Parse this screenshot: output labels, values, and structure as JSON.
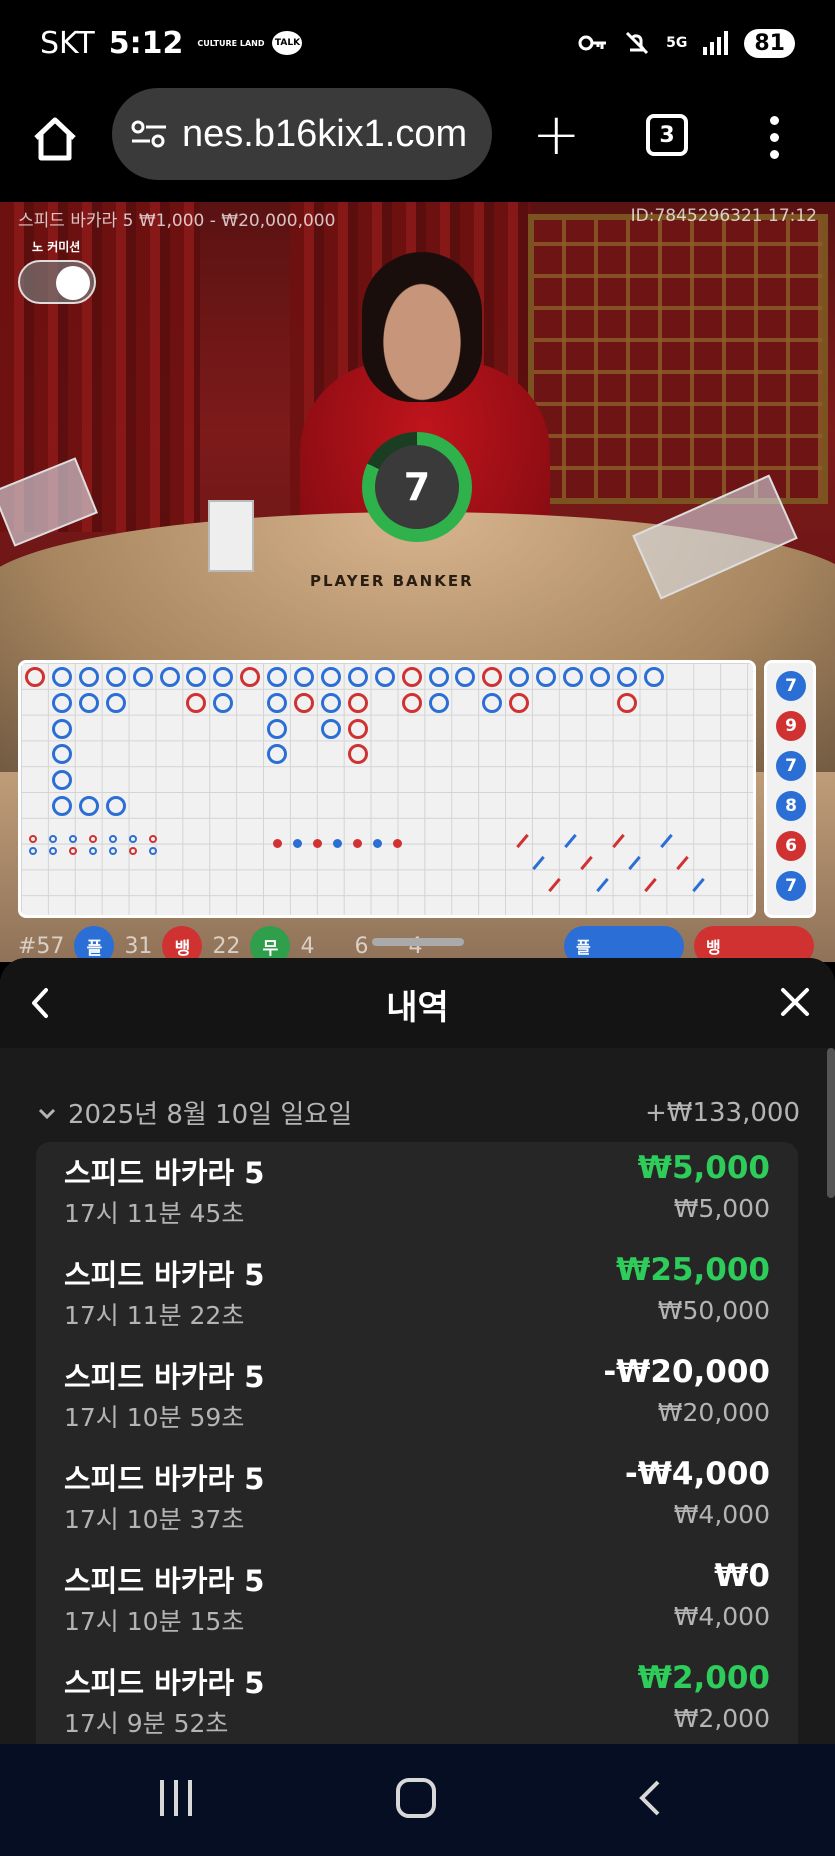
{
  "status_bar": {
    "carrier": "SKT",
    "time": "5:12",
    "culture_land": "CULTURE LAND",
    "talk": "TALK",
    "network": "5G",
    "battery": "81"
  },
  "browser": {
    "url": "nes.b16kix1.com",
    "tab_count": "3"
  },
  "game": {
    "table_info": "스피드 바카라 5  ₩1,000 - ₩20,000,000",
    "round_id": "ID:7845296321  17:12",
    "no_commission_label": "노 커미션",
    "timer_value": "7",
    "table_print": "PLAYER  BANKER",
    "predict_numbers": [
      "7",
      "9",
      "7",
      "8",
      "6",
      "7"
    ],
    "predict_colors": [
      "b",
      "r",
      "b",
      "b",
      "r",
      "b"
    ],
    "stats": {
      "round": "#57",
      "player_label": "플",
      "player_count": "31",
      "banker_label": "뱅",
      "banker_count": "22",
      "tie_label": "무",
      "tie_count": "4",
      "pair1_count": "6",
      "pair2_count": "4",
      "ask_player": "플",
      "ask_banker": "뱅"
    },
    "colors": {
      "player": "#2b6fd6",
      "banker": "#d03232",
      "tie": "#2f9f4b"
    }
  },
  "history_sheet": {
    "title": "내역",
    "date": "2025년 8월 10일 일요일",
    "date_total": "+₩133,000",
    "items": [
      {
        "game": "스피드 바카라 5",
        "time": "17시 11분 45초",
        "result": "₩5,000",
        "bet": "₩5,000",
        "result_color": "#2ecc5a"
      },
      {
        "game": "스피드 바카라 5",
        "time": "17시 11분 22초",
        "result": "₩25,000",
        "bet": "₩50,000",
        "result_color": "#2ecc5a"
      },
      {
        "game": "스피드 바카라 5",
        "time": "17시 10분 59초",
        "result": "-₩20,000",
        "bet": "₩20,000",
        "result_color": "#ffffff"
      },
      {
        "game": "스피드 바카라 5",
        "time": "17시 10분 37초",
        "result": "-₩4,000",
        "bet": "₩4,000",
        "result_color": "#ffffff"
      },
      {
        "game": "스피드 바카라 5",
        "time": "17시 10분 15초",
        "result": "₩0",
        "bet": "₩4,000",
        "result_color": "#ffffff"
      },
      {
        "game": "스피드 바카라 5",
        "time": "17시 9분 52초",
        "result": "₩2,000",
        "bet": "₩2,000",
        "result_color": "#2ecc5a"
      }
    ]
  },
  "icons": [
    "home-icon",
    "site-settings-icon",
    "plus-icon",
    "tabs-icon",
    "more-icon",
    "back-icon",
    "close-icon",
    "chevron-down-icon",
    "recents-icon",
    "home-nav-icon",
    "back-nav-icon"
  ]
}
